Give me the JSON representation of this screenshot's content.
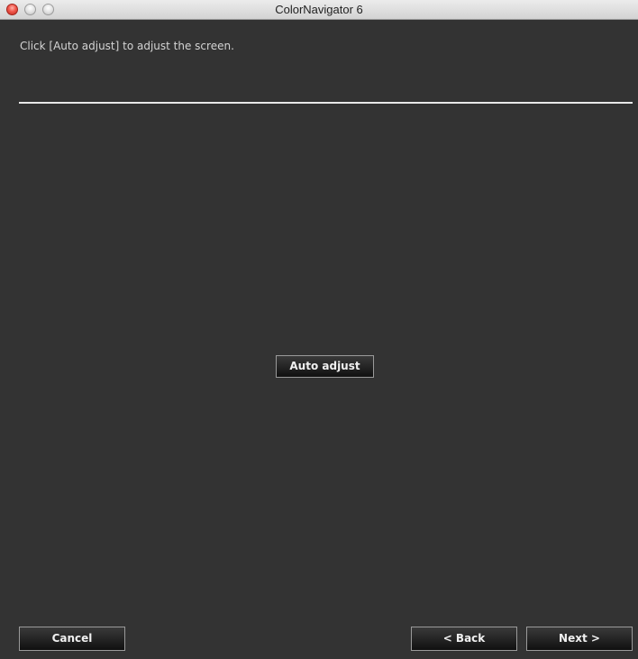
{
  "window": {
    "title": "ColorNavigator 6"
  },
  "content": {
    "instruction": "Click [Auto adjust] to adjust the screen.",
    "auto_adjust_label": "Auto adjust"
  },
  "footer": {
    "cancel_label": "Cancel",
    "back_label": "< Back",
    "next_label": "Next >"
  },
  "colors": {
    "background": "#333333",
    "text": "#d4d4d4",
    "button_border": "#9a9a9a"
  }
}
